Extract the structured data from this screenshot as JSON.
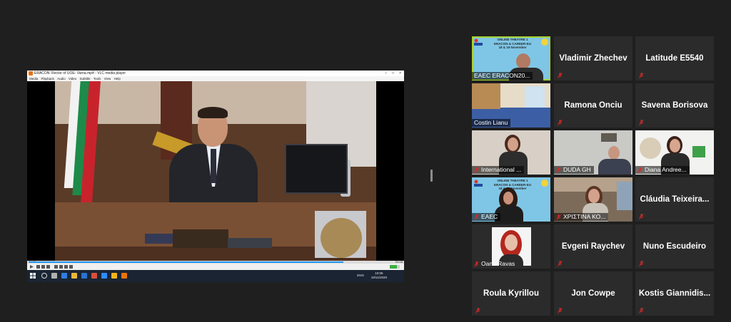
{
  "shared_screen": {
    "window_title": "ERACON: Rector of UOE- Varnа.mp4 - VLC media player",
    "menu": [
      "Media",
      "Playback",
      "Audio",
      "Video",
      "Subtitle",
      "Tools",
      "View",
      "Help"
    ],
    "time_elapsed": "00:37",
    "time_total": "01:16",
    "progress": 0.88,
    "volume": 0.7,
    "taskbar": {
      "lang": "ENG",
      "time": "10:06",
      "date": "19/11/2020"
    }
  },
  "participants": [
    {
      "name": "EAEC ERACON20...",
      "type": "video",
      "active": true,
      "muted": false,
      "banner": [
        "ONLINE THEATRE 1",
        "ERACON & CAREER-EU",
        "18 & 19 November"
      ]
    },
    {
      "name": "Vladimir Zhechev",
      "type": "name",
      "muted": true
    },
    {
      "name": "Latitude E5540",
      "type": "name",
      "muted": true
    },
    {
      "name": "Costin Lianu",
      "type": "video",
      "muted": false
    },
    {
      "name": "Ramona Onciu",
      "type": "name",
      "muted": true
    },
    {
      "name": "Savena Borisova",
      "type": "name",
      "muted": true
    },
    {
      "name": "International ...",
      "type": "video",
      "muted": true
    },
    {
      "name": "DUDA GH",
      "type": "video",
      "muted": true
    },
    {
      "name": "Diana Andree...",
      "type": "video",
      "muted": true
    },
    {
      "name": "EAEC",
      "type": "video",
      "muted": true,
      "banner": [
        "ONLINE THEATRE 1",
        "ERACON & CAREER-EU",
        "18 & 19 November"
      ]
    },
    {
      "name": "ΧΡΙΣΤΙΝΑ ΚΟ...",
      "type": "video",
      "muted": true
    },
    {
      "name": "Cláudia Teixeira...",
      "type": "name",
      "muted": true
    },
    {
      "name": "Oana Ravas",
      "type": "video",
      "muted": true
    },
    {
      "name": "Evgeni Raychev",
      "type": "name",
      "muted": true
    },
    {
      "name": "Nuno Escudeiro",
      "type": "name",
      "muted": true
    },
    {
      "name": "Roula Kyrillou",
      "type": "name",
      "muted": true
    },
    {
      "name": "Jon Cowpe",
      "type": "name",
      "muted": true
    },
    {
      "name": "Kostis Giannidis...",
      "type": "name",
      "muted": true
    }
  ],
  "colors": {
    "background": "#1f1f1f",
    "tile": "#2b2b2b",
    "active_border": "#a6d233",
    "muted_icon": "#e02828"
  }
}
